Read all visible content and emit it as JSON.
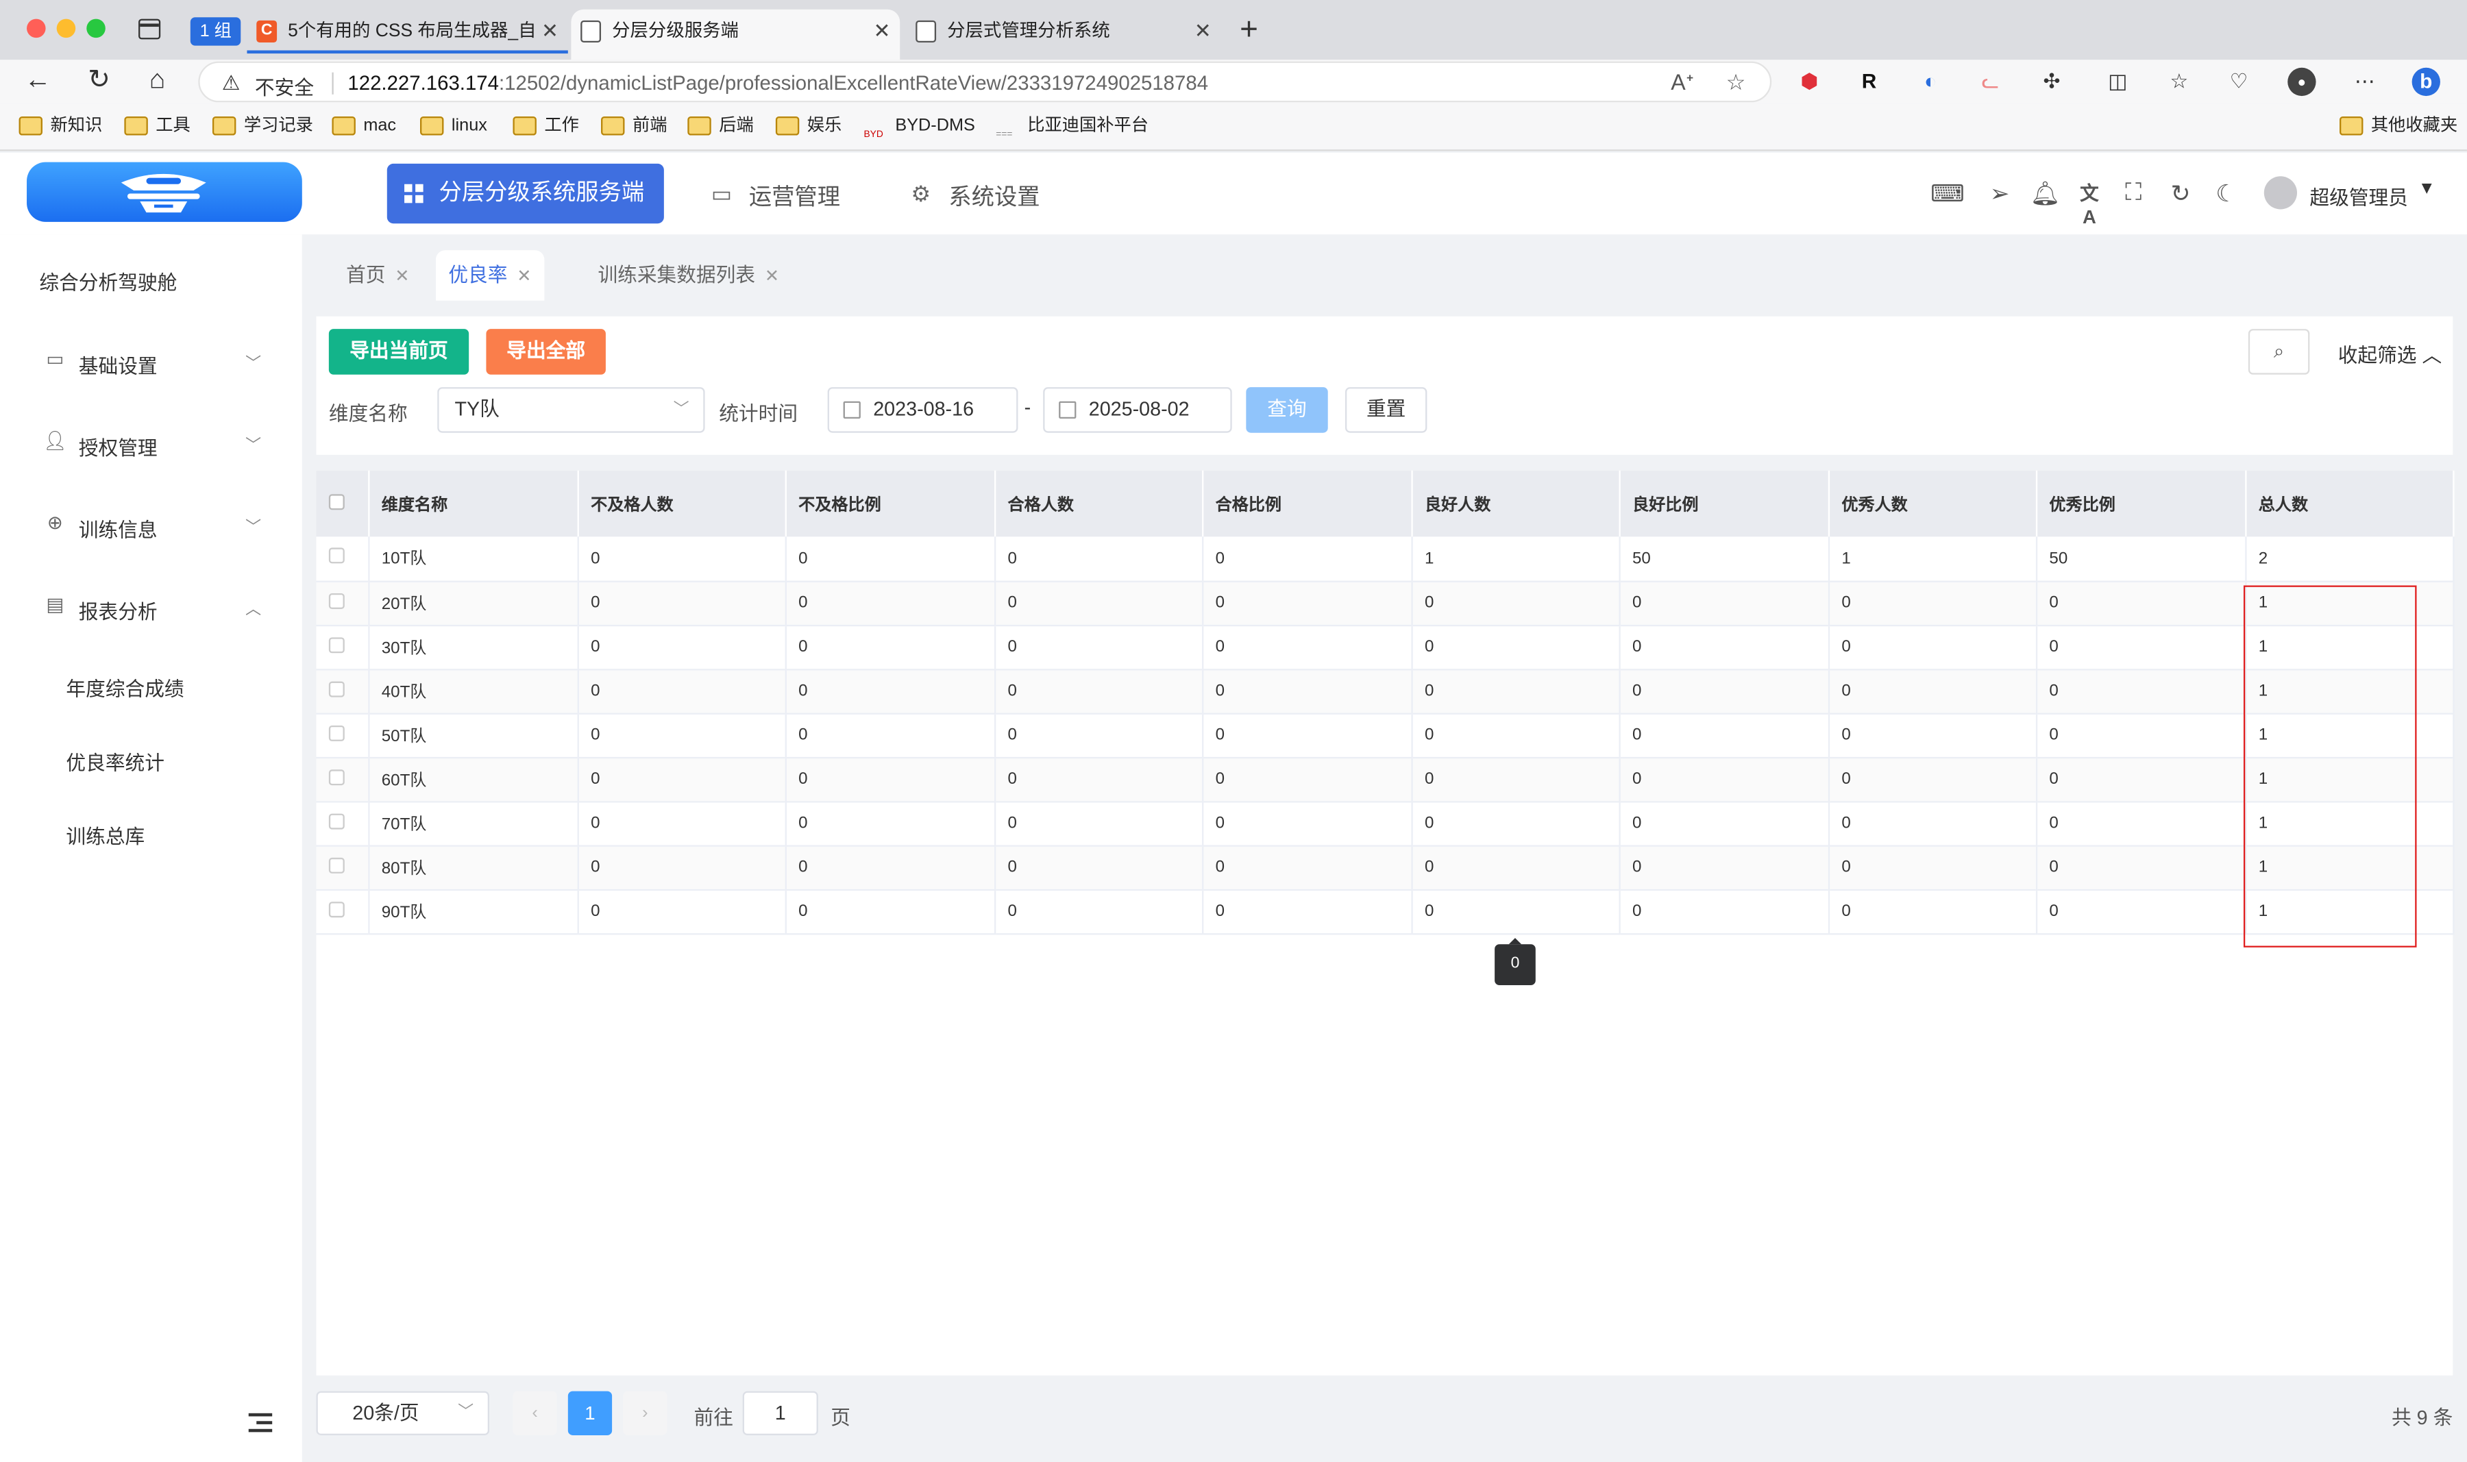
{
  "browser": {
    "group_badge": "1 组",
    "tabs": [
      {
        "title": "5个有用的 CSS 布局生成器_自",
        "fav": "C"
      },
      {
        "title": "分层分级服务端"
      },
      {
        "title": "分层式管理分析系统"
      }
    ],
    "address": {
      "insecure_label": "不安全",
      "url_host": "122.227.163.174",
      "url_rest": ":12502/dynamicListPage/professionalExcellentRateView/233319724902518784"
    },
    "bookmarks": [
      "新知识",
      "工具",
      "学习记录",
      "mac",
      "linux",
      "工作",
      "前端",
      "后端",
      "娱乐",
      "BYD-DMS",
      "比亚迪国补平台"
    ],
    "other_bookmarks": "其他收藏夹"
  },
  "header": {
    "app_title": "分层分级系统服务端",
    "nav": [
      "运营管理",
      "系统设置"
    ],
    "username": "超级管理员"
  },
  "sidebar": {
    "cockpit": "综合分析驾驶舱",
    "menus": [
      {
        "label": "基础设置",
        "icon": "card-icon",
        "expanded": false
      },
      {
        "label": "授权管理",
        "icon": "user-icon",
        "expanded": false
      },
      {
        "label": "训练信息",
        "icon": "target-icon",
        "expanded": false
      },
      {
        "label": "报表分析",
        "icon": "report-icon",
        "expanded": true
      }
    ],
    "submenu": [
      "年度综合成绩",
      "优良率统计",
      "训练总库"
    ]
  },
  "tags": [
    "首页",
    "优良率",
    "训练采集数据列表"
  ],
  "filter": {
    "export_page": "导出当前页",
    "export_all": "导出全部",
    "collapse_label": "收起筛选",
    "dimension_label": "维度名称",
    "dimension_value": "TY队",
    "time_label": "统计时间",
    "date_start": "2023-08-16",
    "date_sep": "-",
    "date_end": "2025-08-02",
    "query": "查询",
    "reset": "重置"
  },
  "table": {
    "columns": [
      "维度名称",
      "不及格人数",
      "不及格比例",
      "合格人数",
      "合格比例",
      "良好人数",
      "良好比例",
      "优秀人数",
      "优秀比例",
      "总人数"
    ],
    "rows": [
      [
        "10T队",
        "0",
        "0",
        "0",
        "0",
        "1",
        "50",
        "1",
        "50",
        "2"
      ],
      [
        "20T队",
        "0",
        "0",
        "0",
        "0",
        "0",
        "0",
        "0",
        "0",
        "1"
      ],
      [
        "30T队",
        "0",
        "0",
        "0",
        "0",
        "0",
        "0",
        "0",
        "0",
        "1"
      ],
      [
        "40T队",
        "0",
        "0",
        "0",
        "0",
        "0",
        "0",
        "0",
        "0",
        "1"
      ],
      [
        "50T队",
        "0",
        "0",
        "0",
        "0",
        "0",
        "0",
        "0",
        "0",
        "1"
      ],
      [
        "60T队",
        "0",
        "0",
        "0",
        "0",
        "0",
        "0",
        "0",
        "0",
        "1"
      ],
      [
        "70T队",
        "0",
        "0",
        "0",
        "0",
        "0",
        "0",
        "0",
        "0",
        "1"
      ],
      [
        "80T队",
        "0",
        "0",
        "0",
        "0",
        "0",
        "0",
        "0",
        "0",
        "1"
      ],
      [
        "90T队",
        "0",
        "0",
        "0",
        "0",
        "0",
        "0",
        "0",
        "0",
        "1"
      ]
    ],
    "tooltip": "0"
  },
  "pager": {
    "page_size": "20条/页",
    "current": "1",
    "goto_label": "前往",
    "goto_value": "1",
    "page_unit": "页",
    "total": "共 9 条"
  },
  "colors": {
    "primary": "#3f6fe0",
    "export_green": "#13b48a",
    "export_orange": "#fa7e4b",
    "highlight": "#e02020"
  }
}
